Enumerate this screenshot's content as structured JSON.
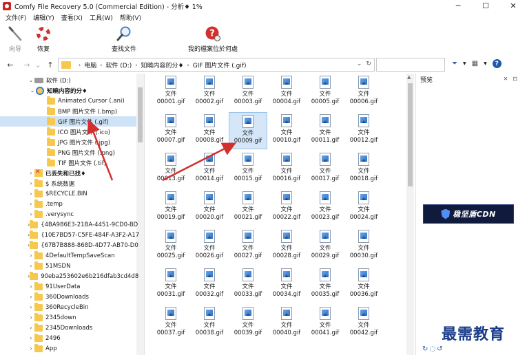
{
  "window": {
    "title": "Comfy File Recovery 5.0 (Commercial Edition) - 分析♦ 1%",
    "minimize": "─",
    "maximize": "☐",
    "close": "✕"
  },
  "menu": [
    "文件(F)",
    "编辑(Y)",
    "查看(X)",
    "工具(W)",
    "帮助(V)"
  ],
  "toolbar": {
    "wizard": "向导",
    "restore": "恢复",
    "find": "查找文件",
    "where": "我的檔案位於何處"
  },
  "nav": {
    "back": "←",
    "forward": "→",
    "dropdown": "⌄",
    "up": "↑",
    "path": [
      "电脑",
      "软件 (D:)",
      "知曉内容的分♦",
      "GIF 图片文件 (.gif)"
    ],
    "path_sep": "›",
    "refresh": "↻",
    "filter_icon": "▼",
    "view_icon": "▦",
    "help": "?"
  },
  "tree": [
    {
      "label": "软件 (D:)",
      "kind": "drive",
      "indent": 0,
      "chev": "⌄"
    },
    {
      "label": "知曉内容的分♦",
      "kind": "search",
      "indent": 1,
      "chev": "⌄",
      "bold": true
    },
    {
      "label": "Animated Cursor (.ani)",
      "kind": "folder",
      "indent": 2,
      "chev": ""
    },
    {
      "label": "BMP 图片文件 (.bmp)",
      "kind": "folder",
      "indent": 2,
      "chev": ""
    },
    {
      "label": "GIF 图片文件 (.gif)",
      "kind": "folder",
      "indent": 2,
      "chev": "",
      "selected": true
    },
    {
      "label": "ICO 图片文件 (.ico)",
      "kind": "folder",
      "indent": 2,
      "chev": ""
    },
    {
      "label": "JPG 图片文件 (.jpg)",
      "kind": "folder",
      "indent": 2,
      "chev": ""
    },
    {
      "label": "PNG 图片文件 (.png)",
      "kind": "folder",
      "indent": 2,
      "chev": ""
    },
    {
      "label": "TIF 图片文件 (.tif)",
      "kind": "folder",
      "indent": 2,
      "chev": ""
    },
    {
      "label": "已丢失和已找♦",
      "kind": "lost",
      "indent": 1,
      "chev": "›",
      "bold": true
    },
    {
      "label": "$ 系统数据",
      "kind": "folder",
      "indent": 1,
      "chev": "›"
    },
    {
      "label": "$RECYCLE.BIN",
      "kind": "folder",
      "indent": 1,
      "chev": "›"
    },
    {
      "label": ".temp",
      "kind": "folder",
      "indent": 1,
      "chev": "›"
    },
    {
      "label": ".verysync",
      "kind": "folder",
      "indent": 1,
      "chev": "›"
    },
    {
      "label": "{4BA986E3-21BA-4451-9CD0-BD",
      "kind": "folder",
      "indent": 1,
      "chev": "›"
    },
    {
      "label": "{10E7BD57-C5FE-484F-A3F2-A17",
      "kind": "folder",
      "indent": 1,
      "chev": "›"
    },
    {
      "label": "{67B7B888-868D-4D77-AB70-D0",
      "kind": "folder",
      "indent": 1,
      "chev": "›"
    },
    {
      "label": "4DefaultTempSaveScan",
      "kind": "folder",
      "indent": 1,
      "chev": "›"
    },
    {
      "label": "51MSDN",
      "kind": "folder",
      "indent": 1,
      "chev": "›"
    },
    {
      "label": "90eba253602e6b216dfab3cd4d8",
      "kind": "folder",
      "indent": 1,
      "chev": "›"
    },
    {
      "label": "91UserData",
      "kind": "folder",
      "indent": 1,
      "chev": "›"
    },
    {
      "label": "360Downloads",
      "kind": "folder",
      "indent": 1,
      "chev": "›"
    },
    {
      "label": "360RecycleBin",
      "kind": "folder",
      "indent": 1,
      "chev": "›"
    },
    {
      "label": "2345down",
      "kind": "folder",
      "indent": 1,
      "chev": "›"
    },
    {
      "label": "2345Downloads",
      "kind": "folder",
      "indent": 1,
      "chev": "›"
    },
    {
      "label": "2496",
      "kind": "folder",
      "indent": 1,
      "chev": "›"
    },
    {
      "label": "App",
      "kind": "folder",
      "indent": 1,
      "chev": "›"
    }
  ],
  "files": {
    "prefix": "文件",
    "names": [
      "00001.gif",
      "00002.gif",
      "00003.gif",
      "00004.gif",
      "00005.gif",
      "00006.gif",
      "00007.gif",
      "00008.gif",
      "00009.gif",
      "00010.gif",
      "00011.gif",
      "00012.gif",
      "00013.gif",
      "00014.gif",
      "00015.gif",
      "00016.gif",
      "00017.gif",
      "00018.gif",
      "00019.gif",
      "00020.gif",
      "00021.gif",
      "00022.gif",
      "00023.gif",
      "00024.gif",
      "00025.gif",
      "00026.gif",
      "00027.gif",
      "00028.gif",
      "00029.gif",
      "00030.gif",
      "00031.gif",
      "00032.gif",
      "00033.gif",
      "00034.gif",
      "00035.gif",
      "00036.gif",
      "00037.gif",
      "00038.gif",
      "00039.gif",
      "00040.gif",
      "00041.gif",
      "00042.gif"
    ],
    "selected": "00009.gif"
  },
  "preview": {
    "title": "预览",
    "pin": "✕",
    "dock": "⊡",
    "banner_text": "稳坚盾CDN"
  },
  "watermark": "最需教育",
  "corner_icons": "↻◌↺",
  "colors": {
    "selection": "#cfe3f7",
    "folder": "#f6c94e",
    "arrow": "#d32f2f",
    "banner_bg": "#0f1a3d",
    "watermark": "#1a3c8a"
  }
}
